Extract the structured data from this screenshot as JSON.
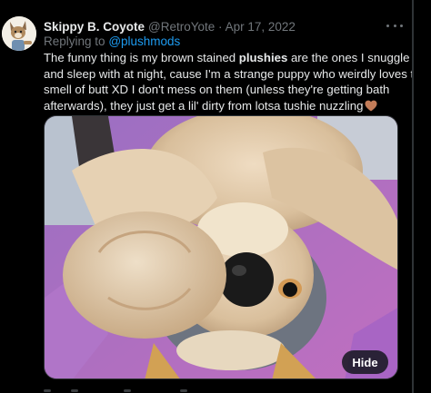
{
  "tweet": {
    "author": {
      "display_name": "Skippy B. Coyote",
      "handle": "@RetroYote",
      "separator": "·",
      "date": "Apr 17, 2022",
      "avatar_icon": "coyote-avatar"
    },
    "replying_to": {
      "prefix": "Replying to",
      "mention": "@plushmods"
    },
    "text_lines": [
      {
        "before": "The funny thing is my brown stained ",
        "bold": "plushies",
        "after": " are the ones I snuggle up"
      },
      {
        "text": "and sleep with at night, cause I'm a strange puppy who weirdly loves the"
      },
      {
        "text": "smell of butt XD I don't mess on them (unless they're getting bath"
      },
      {
        "text": "afterwards), they just get a lil' dirty from lotsa tushie nuzzling",
        "emoji": "brown-heart-icon"
      }
    ],
    "media": {
      "hide_label": "Hide",
      "image_icon": "plush-coyote-photo"
    },
    "more_icon": "more-options-icon"
  },
  "colors": {
    "background": "#000000",
    "text": "#e7e9ea",
    "muted": "#71767b",
    "link": "#1d9bf0",
    "border": "#2f3336",
    "heart": "#c37c58"
  }
}
